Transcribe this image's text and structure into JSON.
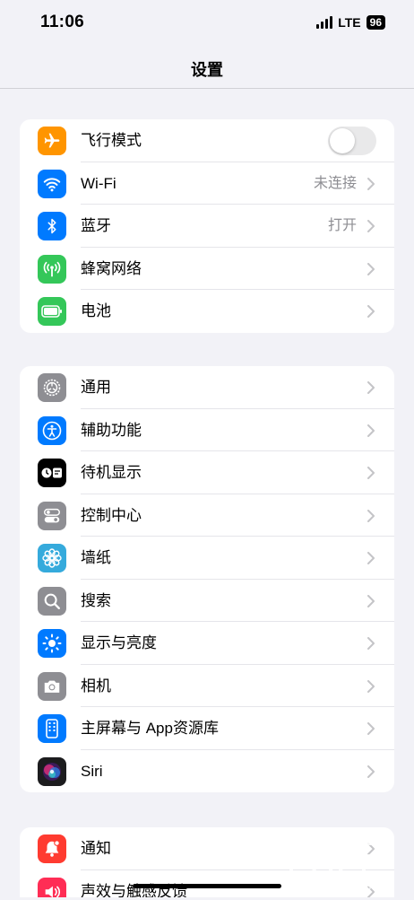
{
  "status_bar": {
    "time": "11:06",
    "network": "LTE",
    "battery": "96"
  },
  "nav": {
    "title": "设置"
  },
  "group1": [
    {
      "label": "飞行模式",
      "icon": "airplane-icon",
      "color": "#ff9500",
      "toggle": false
    },
    {
      "label": "Wi-Fi",
      "icon": "wifi-icon",
      "color": "#007aff",
      "value": "未连接"
    },
    {
      "label": "蓝牙",
      "icon": "bluetooth-icon",
      "color": "#007aff",
      "value": "打开"
    },
    {
      "label": "蜂窝网络",
      "icon": "cellular-icon",
      "color": "#34c759"
    },
    {
      "label": "电池",
      "icon": "battery-icon",
      "color": "#34c759"
    }
  ],
  "group2": [
    {
      "label": "通用",
      "icon": "gear-icon",
      "color": "#8e8e93"
    },
    {
      "label": "辅助功能",
      "icon": "accessibility-icon",
      "color": "#007aff"
    },
    {
      "label": "待机显示",
      "icon": "standby-icon",
      "color": "#000000"
    },
    {
      "label": "控制中心",
      "icon": "control-center-icon",
      "color": "#8e8e93"
    },
    {
      "label": "墙纸",
      "icon": "wallpaper-icon",
      "color": "#35aadc"
    },
    {
      "label": "搜索",
      "icon": "search-icon",
      "color": "#8e8e93"
    },
    {
      "label": "显示与亮度",
      "icon": "brightness-icon",
      "color": "#007aff"
    },
    {
      "label": "相机",
      "icon": "camera-icon",
      "color": "#8e8e93"
    },
    {
      "label": "主屏幕与 App资源库",
      "icon": "home-screen-icon",
      "color": "#007aff"
    },
    {
      "label": "Siri",
      "icon": "siri-icon",
      "color": "#1c1c1e"
    }
  ],
  "group3": [
    {
      "label": "通知",
      "icon": "notification-icon",
      "color": "#ff3b30"
    },
    {
      "label": "声效与触感反馈",
      "icon": "sound-icon",
      "color": "#ff2d55"
    }
  ],
  "watermark": {
    "text": "HUAREN.US"
  }
}
